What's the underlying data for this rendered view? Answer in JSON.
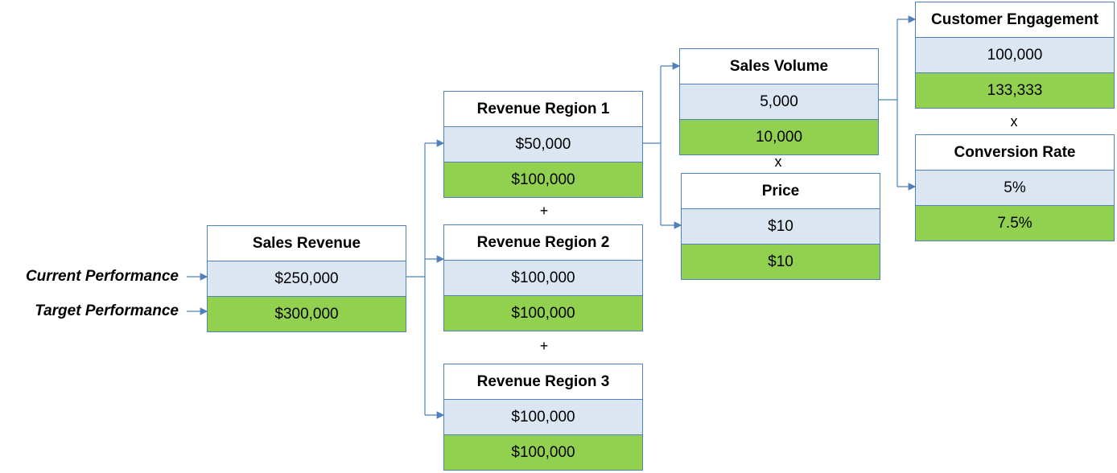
{
  "row_labels": {
    "current": "Current Performance",
    "target": "Target Performance"
  },
  "nodes": {
    "sales_revenue": {
      "title": "Sales Revenue",
      "current": "$250,000",
      "target": "$300,000"
    },
    "region1": {
      "title": "Revenue Region 1",
      "current": "$50,000",
      "target": "$100,000"
    },
    "region2": {
      "title": "Revenue Region 2",
      "current": "$100,000",
      "target": "$100,000"
    },
    "region3": {
      "title": "Revenue Region 3",
      "current": "$100,000",
      "target": "$100,000"
    },
    "sales_volume": {
      "title": "Sales Volume",
      "current": "5,000",
      "target": "10,000"
    },
    "price": {
      "title": "Price",
      "current": "$10",
      "target": "$10"
    },
    "customer_engagement": {
      "title": "Customer Engagement",
      "current": "100,000",
      "target": "133,333"
    },
    "conversion_rate": {
      "title": "Conversion Rate",
      "current": "5%",
      "target": "7.5%"
    }
  },
  "operators": {
    "plus_1": "+",
    "plus_2": "+",
    "times_1": "x",
    "times_2": "x"
  },
  "colors": {
    "current_fill": "#dce6f2",
    "target_fill": "#92d050",
    "border": "#4f81bd",
    "connector": "#4f81bd"
  }
}
